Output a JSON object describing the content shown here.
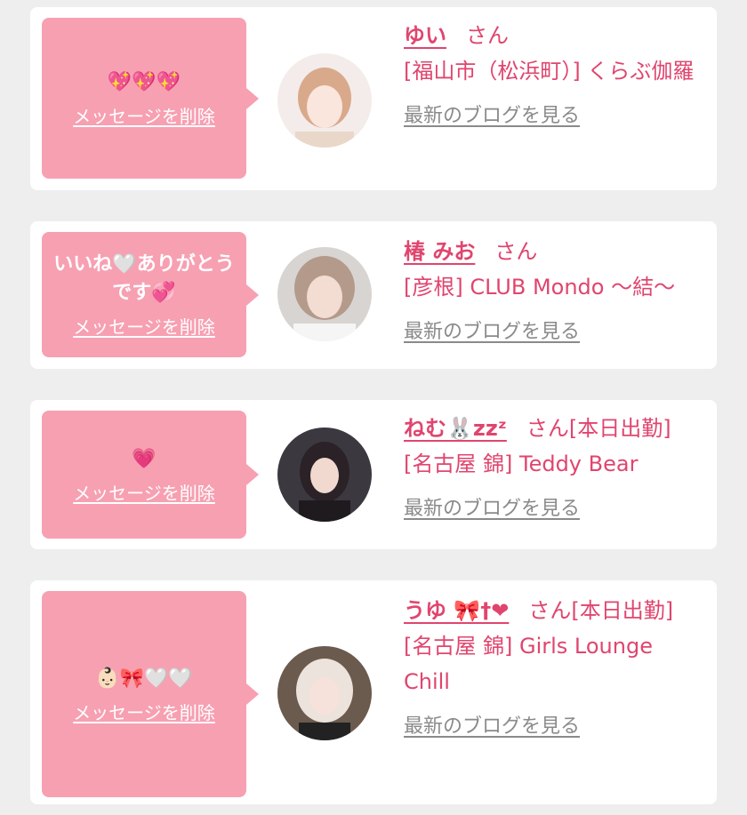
{
  "colors": {
    "accent": "#e0456e",
    "bubble": "#f7a0b2",
    "card": "#ffffff",
    "background": "#eeeeee",
    "muted": "#8a8a8a"
  },
  "cards": [
    {
      "message": "💖💖💖",
      "delete_label": "メッセージを削除",
      "name": "ゆい",
      "honorific": "さん",
      "status": "",
      "shop": "[福山市（松浜町）] くらぶ伽羅",
      "blog_link": "最新のブログを見る"
    },
    {
      "message": "いいね🤍ありがとうです💞",
      "delete_label": "メッセージを削除",
      "name": "椿 みお",
      "honorific": "さん",
      "status": "",
      "shop": "[彦根] CLUB Mondo ～結～",
      "blog_link": "最新のブログを見る"
    },
    {
      "message": "💗",
      "delete_label": "メッセージを削除",
      "name": "ねむ🐰zzᶻ",
      "honorific": "さん",
      "status": "[本日出勤]",
      "shop": "[名古屋 錦] Teddy Bear",
      "blog_link": "最新のブログを見る"
    },
    {
      "message": "👶🏻🎀🤍🤍",
      "delete_label": "メッセージを削除",
      "name": "うゆ 🎀†❤",
      "honorific": "さん",
      "status": "[本日出勤]",
      "shop": "[名古屋 錦] Girls Lounge Chill",
      "blog_link": "最新のブログを見る"
    }
  ]
}
